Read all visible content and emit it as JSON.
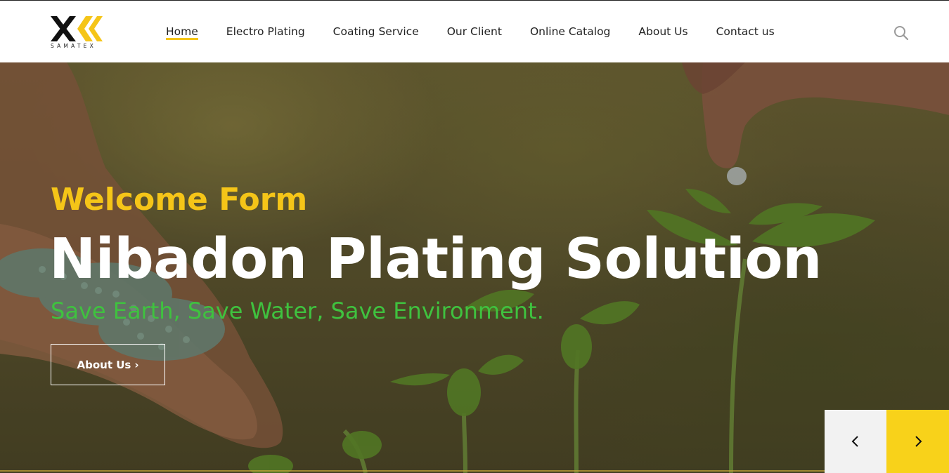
{
  "brand": {
    "logo_text": "SAMATEX",
    "accent": "#f5c518"
  },
  "nav": {
    "items": [
      {
        "label": "Home",
        "active": true
      },
      {
        "label": "Electro Plating",
        "active": false
      },
      {
        "label": "Coating Service",
        "active": false
      },
      {
        "label": "Our Client",
        "active": false
      },
      {
        "label": "Online Catalog",
        "active": false
      },
      {
        "label": "About Us",
        "active": false
      },
      {
        "label": "Contact us",
        "active": false
      }
    ],
    "search_icon": "search-icon"
  },
  "hero": {
    "welcome": "Welcome Form",
    "headline": "Nibadon Plating Solution",
    "tagline": "Save Earth, Save Water, Save Environment.",
    "button_label": "About Us",
    "button_icon": "chevron-right-icon",
    "prev_icon": "chevron-left-icon",
    "next_icon": "chevron-right-icon",
    "colors": {
      "welcome": "#f5c518",
      "headline": "#ffffff",
      "tagline": "#3fc23f",
      "next_bg": "#f8d21a",
      "prev_bg": "#f2f2f2"
    }
  }
}
